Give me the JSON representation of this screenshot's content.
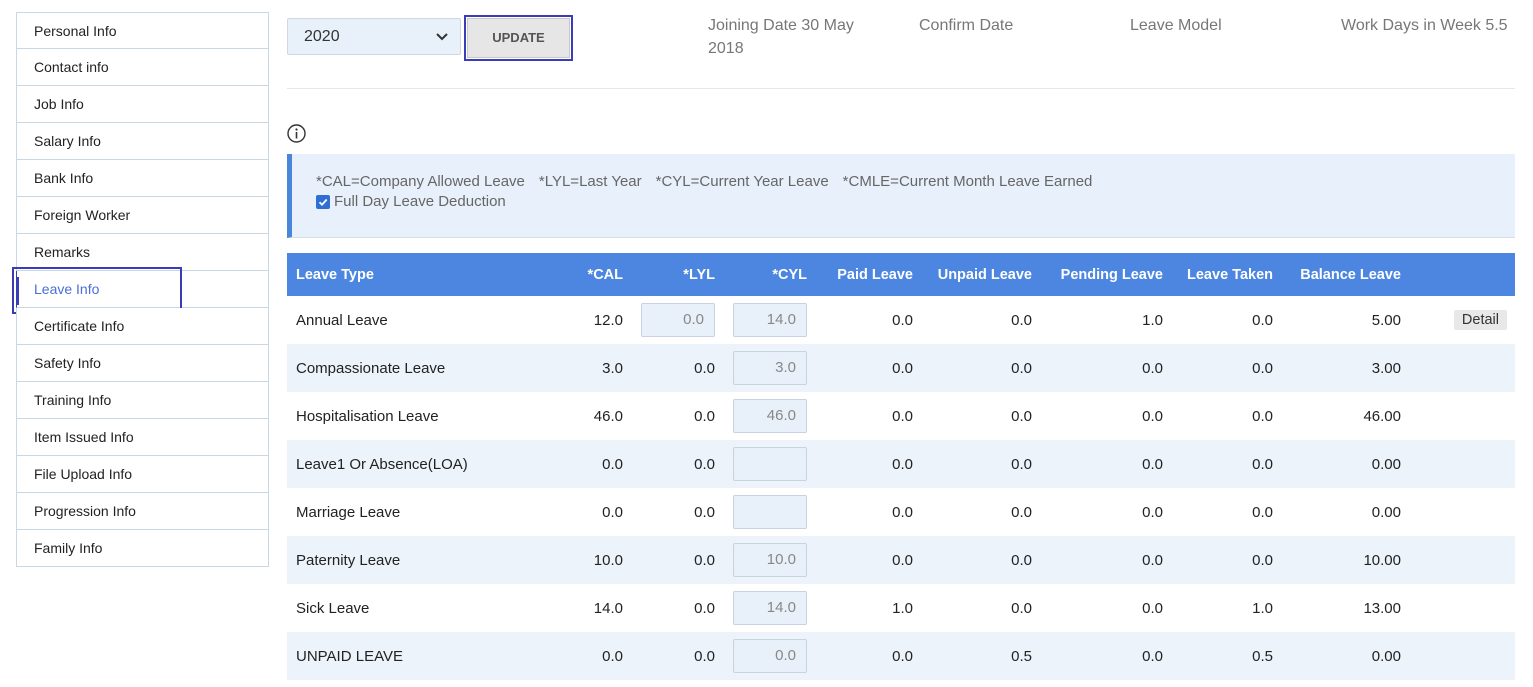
{
  "sidebar": {
    "items": [
      {
        "label": "Personal Info"
      },
      {
        "label": "Contact info"
      },
      {
        "label": "Job Info"
      },
      {
        "label": "Salary Info"
      },
      {
        "label": "Bank Info"
      },
      {
        "label": "Foreign Worker"
      },
      {
        "label": "Remarks"
      },
      {
        "label": "Leave Info",
        "active": true
      },
      {
        "label": "Certificate Info"
      },
      {
        "label": "Safety Info"
      },
      {
        "label": "Training Info"
      },
      {
        "label": "Item Issued Info"
      },
      {
        "label": "File Upload Info"
      },
      {
        "label": "Progression Info"
      },
      {
        "label": "Family Info"
      }
    ]
  },
  "controls": {
    "year_value": "2020",
    "update_label": "UPDATE"
  },
  "meta": {
    "joining_date": "Joining Date 30 May 2018",
    "confirm_date": "Confirm Date",
    "leave_model": "Leave Model",
    "work_days": "Work Days in Week 5.5"
  },
  "notice": {
    "legend": [
      "*CAL=Company Allowed Leave",
      "*LYL=Last Year",
      "*CYL=Current Year Leave",
      "*CMLE=Current Month Leave Earned"
    ],
    "checkbox_label": "Full Day Leave Deduction",
    "checkbox_checked": true
  },
  "table": {
    "headers": [
      "Leave Type",
      "*CAL",
      "*LYL",
      "*CYL",
      "Paid Leave",
      "Unpaid Leave",
      "Pending Leave",
      "Leave Taken",
      "Balance Leave",
      ""
    ],
    "rows": [
      {
        "type": "Annual Leave",
        "cal": "12.0",
        "lyl": "0.0",
        "lyl_input": true,
        "cyl": "14.0",
        "paid": "0.0",
        "unpaid": "0.0",
        "pending": "1.0",
        "taken": "0.0",
        "balance": "5.00",
        "action": "Detail"
      },
      {
        "type": "Compassionate Leave",
        "cal": "3.0",
        "lyl": "0.0",
        "lyl_input": false,
        "cyl": "3.0",
        "paid": "0.0",
        "unpaid": "0.0",
        "pending": "0.0",
        "taken": "0.0",
        "balance": "3.00",
        "action": ""
      },
      {
        "type": "Hospitalisation Leave",
        "cal": "46.0",
        "lyl": "0.0",
        "lyl_input": false,
        "cyl": "46.0",
        "paid": "0.0",
        "unpaid": "0.0",
        "pending": "0.0",
        "taken": "0.0",
        "balance": "46.00",
        "action": ""
      },
      {
        "type": "Leave1 Or Absence(LOA)",
        "cal": "0.0",
        "lyl": "0.0",
        "lyl_input": false,
        "cyl": "",
        "paid": "0.0",
        "unpaid": "0.0",
        "pending": "0.0",
        "taken": "0.0",
        "balance": "0.00",
        "action": ""
      },
      {
        "type": "Marriage Leave",
        "cal": "0.0",
        "lyl": "0.0",
        "lyl_input": false,
        "cyl": "",
        "paid": "0.0",
        "unpaid": "0.0",
        "pending": "0.0",
        "taken": "0.0",
        "balance": "0.00",
        "action": ""
      },
      {
        "type": "Paternity Leave",
        "cal": "10.0",
        "lyl": "0.0",
        "lyl_input": false,
        "cyl": "10.0",
        "paid": "0.0",
        "unpaid": "0.0",
        "pending": "0.0",
        "taken": "0.0",
        "balance": "10.00",
        "action": ""
      },
      {
        "type": "Sick Leave",
        "cal": "14.0",
        "lyl": "0.0",
        "lyl_input": false,
        "cyl": "14.0",
        "paid": "1.0",
        "unpaid": "0.0",
        "pending": "0.0",
        "taken": "1.0",
        "balance": "13.00",
        "action": ""
      },
      {
        "type": "UNPAID LEAVE",
        "cal": "0.0",
        "lyl": "0.0",
        "lyl_input": false,
        "cyl": "0.0",
        "paid": "0.0",
        "unpaid": "0.5",
        "pending": "0.0",
        "taken": "0.5",
        "balance": "0.00",
        "action": ""
      }
    ]
  },
  "icons": {
    "select_chevron": "chevron-down-icon",
    "info": "info-icon",
    "checkbox": "checkmark-icon"
  },
  "colors": {
    "table_header": "#4c86e0",
    "accent_outline": "#3b3db8",
    "notice_bg": "#e8f1fb"
  }
}
